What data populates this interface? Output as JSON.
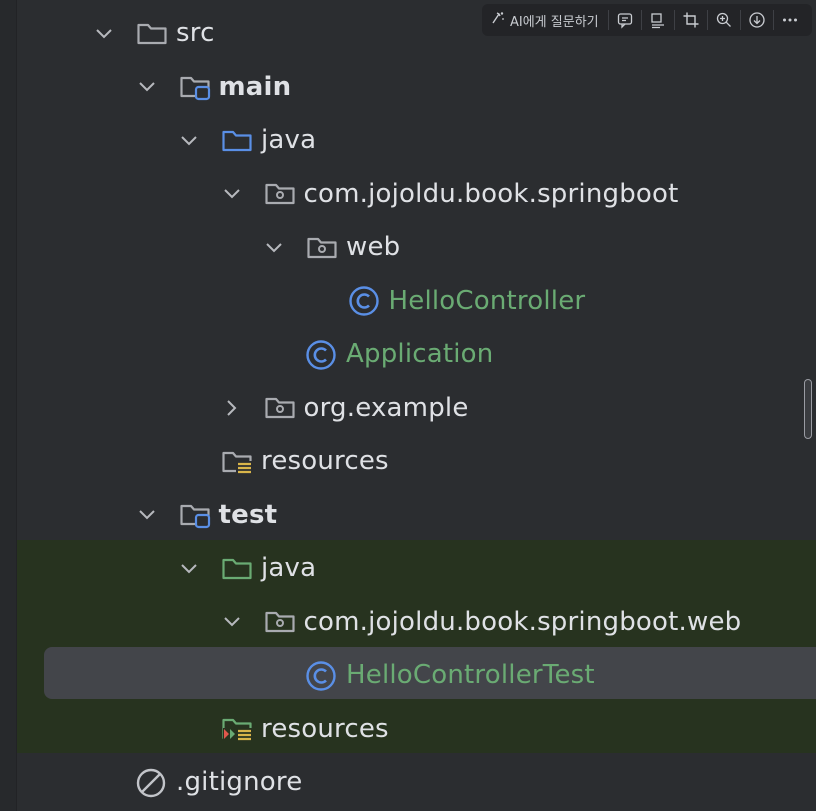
{
  "toolbar": {
    "ask_ai_label": "AI에게 질문하기",
    "buttons": [
      "comment-icon",
      "outline-icon",
      "crop-icon",
      "zoom-in-icon",
      "download-icon",
      "more-icon"
    ]
  },
  "colors": {
    "background": "#2b2d30",
    "test_sources_band": "#27331f",
    "selected_row": "#43454a",
    "class_name": "#6aab73",
    "folder_stroke": "#a9abb0",
    "source_root_blue": "#5a8fe6",
    "test_root_green": "#6aab73"
  },
  "tree": {
    "items": [
      {
        "label": "src",
        "depth": 0,
        "expanded": true,
        "icon": "folder-icon"
      },
      {
        "label": "main",
        "depth": 1,
        "expanded": true,
        "icon": "module-folder-icon"
      },
      {
        "label": "java",
        "depth": 2,
        "expanded": true,
        "icon": "source-root-folder-icon"
      },
      {
        "label": "com.jojoldu.book.springboot",
        "depth": 3,
        "expanded": true,
        "icon": "package-icon"
      },
      {
        "label": "web",
        "depth": 4,
        "expanded": true,
        "icon": "package-icon"
      },
      {
        "label": "HelloController",
        "depth": 5,
        "icon": "class-icon"
      },
      {
        "label": "Application",
        "depth": 4,
        "icon": "class-icon"
      },
      {
        "label": "org.example",
        "depth": 3,
        "expanded": false,
        "icon": "package-icon"
      },
      {
        "label": "resources",
        "depth": 2,
        "icon": "resources-folder-icon"
      },
      {
        "label": "test",
        "depth": 1,
        "expanded": true,
        "icon": "module-folder-icon"
      },
      {
        "label": "java",
        "depth": 2,
        "expanded": true,
        "icon": "test-root-folder-icon"
      },
      {
        "label": "com.jojoldu.book.springboot.web",
        "depth": 3,
        "expanded": true,
        "icon": "package-icon"
      },
      {
        "label": "HelloControllerTest",
        "depth": 4,
        "icon": "class-icon",
        "selected": true
      },
      {
        "label": "resources",
        "depth": 2,
        "icon": "test-resources-folder-icon"
      },
      {
        "label": ".gitignore",
        "depth": 0,
        "icon": "ignored-file-icon"
      }
    ]
  }
}
